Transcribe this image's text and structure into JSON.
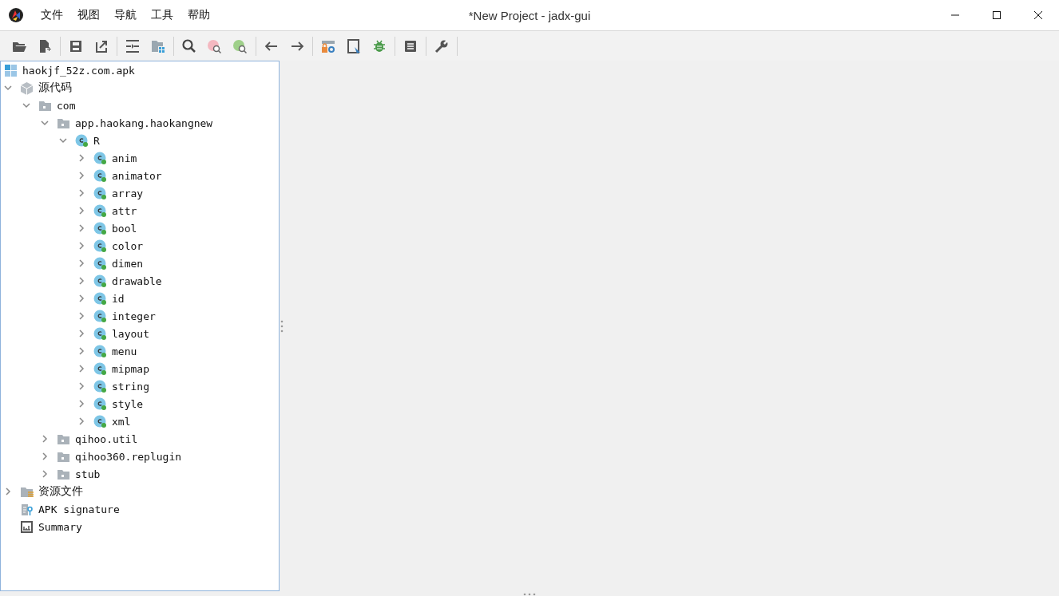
{
  "window": {
    "title": "*New Project - jadx-gui"
  },
  "menu": [
    "文件",
    "视图",
    "导航",
    "工具",
    "帮助"
  ],
  "tree": {
    "root": {
      "label": "haokjf_52z.com.apk",
      "kind": "apk"
    },
    "items": [
      {
        "label": "源代码",
        "kind": "package",
        "expanded": true,
        "children": [
          {
            "label": "com",
            "kind": "folder",
            "expanded": true,
            "children": [
              {
                "label": "app.haokang.haokangnew",
                "kind": "folder",
                "expanded": true,
                "children": [
                  {
                    "label": "R",
                    "kind": "class",
                    "expanded": true,
                    "children": [
                      {
                        "label": "anim",
                        "kind": "class",
                        "expanded": false
                      },
                      {
                        "label": "animator",
                        "kind": "class",
                        "expanded": false
                      },
                      {
                        "label": "array",
                        "kind": "class",
                        "expanded": false
                      },
                      {
                        "label": "attr",
                        "kind": "class",
                        "expanded": false
                      },
                      {
                        "label": "bool",
                        "kind": "class",
                        "expanded": false
                      },
                      {
                        "label": "color",
                        "kind": "class",
                        "expanded": false
                      },
                      {
                        "label": "dimen",
                        "kind": "class",
                        "expanded": false
                      },
                      {
                        "label": "drawable",
                        "kind": "class",
                        "expanded": false
                      },
                      {
                        "label": "id",
                        "kind": "class",
                        "expanded": false
                      },
                      {
                        "label": "integer",
                        "kind": "class",
                        "expanded": false
                      },
                      {
                        "label": "layout",
                        "kind": "class",
                        "expanded": false
                      },
                      {
                        "label": "menu",
                        "kind": "class",
                        "expanded": false
                      },
                      {
                        "label": "mipmap",
                        "kind": "class",
                        "expanded": false
                      },
                      {
                        "label": "string",
                        "kind": "class",
                        "expanded": false
                      },
                      {
                        "label": "style",
                        "kind": "class",
                        "expanded": false
                      },
                      {
                        "label": "xml",
                        "kind": "class",
                        "expanded": false
                      }
                    ]
                  }
                ]
              },
              {
                "label": "qihoo.util",
                "kind": "folder",
                "expanded": false
              },
              {
                "label": "qihoo360.replugin",
                "kind": "folder",
                "expanded": false
              },
              {
                "label": "stub",
                "kind": "folder",
                "expanded": false
              }
            ]
          }
        ]
      },
      {
        "label": "资源文件",
        "kind": "resources",
        "expanded": false
      },
      {
        "label": "APK signature",
        "kind": "signature"
      },
      {
        "label": "Summary",
        "kind": "summary"
      }
    ]
  }
}
